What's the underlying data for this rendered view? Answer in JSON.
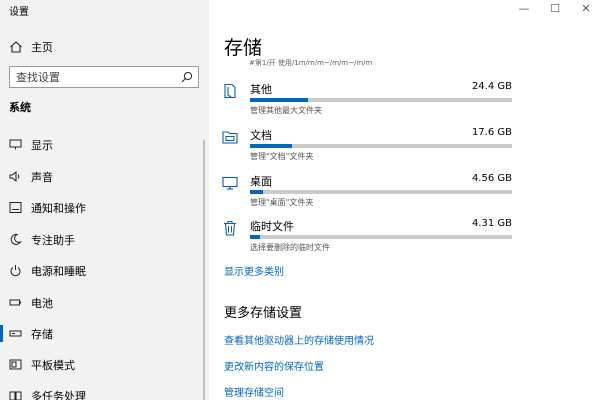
{
  "app": {
    "title": "设置"
  },
  "home": {
    "label": "主页",
    "icon": "home-icon"
  },
  "search": {
    "placeholder": "查找设置",
    "icon": "search-icon"
  },
  "sidebar": {
    "section_title": "系统",
    "items": [
      {
        "label": "显示",
        "icon": "display-icon"
      },
      {
        "label": "声音",
        "icon": "speaker-icon"
      },
      {
        "label": "通知和操作",
        "icon": "notification-icon"
      },
      {
        "label": "专注助手",
        "icon": "moon-icon"
      },
      {
        "label": "电源和睡眠",
        "icon": "power-icon"
      },
      {
        "label": "电池",
        "icon": "battery-icon"
      },
      {
        "label": "存储",
        "icon": "storage-icon",
        "active": true
      },
      {
        "label": "平板模式",
        "icon": "tablet-icon"
      },
      {
        "label": "多任务处理",
        "icon": "multitask-icon"
      }
    ]
  },
  "window": {
    "minimize": "—",
    "maximize": "☐",
    "close": "✕"
  },
  "page": {
    "title": "存储",
    "clipped_note": "#第1/开 使用/1m/m/m~/m/m~/m/m",
    "categories": [
      {
        "name": "其他",
        "size": "24.4 GB",
        "desc": "管理其他最大文件夹",
        "fill": 0.22,
        "icon": "other-files-icon"
      },
      {
        "name": "文档",
        "size": "17.6 GB",
        "desc": "管理\"文档\"文件夹",
        "fill": 0.16,
        "icon": "documents-folder-icon"
      },
      {
        "name": "桌面",
        "size": "4.56 GB",
        "desc": "管理\"桌面\"文件夹",
        "fill": 0.05,
        "icon": "desktop-icon"
      },
      {
        "name": "临时文件",
        "size": "4.31 GB",
        "desc": "选择要删除的临时文件",
        "fill": 0.04,
        "icon": "trash-icon"
      }
    ],
    "show_more": "显示更多类别",
    "more_settings_title": "更多存储设置",
    "links": [
      "查看其他驱动器上的存储使用情况",
      "更改新内容的保存位置",
      "管理存储空间"
    ]
  },
  "colors": {
    "accent": "#0067c0",
    "sidebar_bg": "#f2f2f2",
    "track": "#cccccc"
  }
}
